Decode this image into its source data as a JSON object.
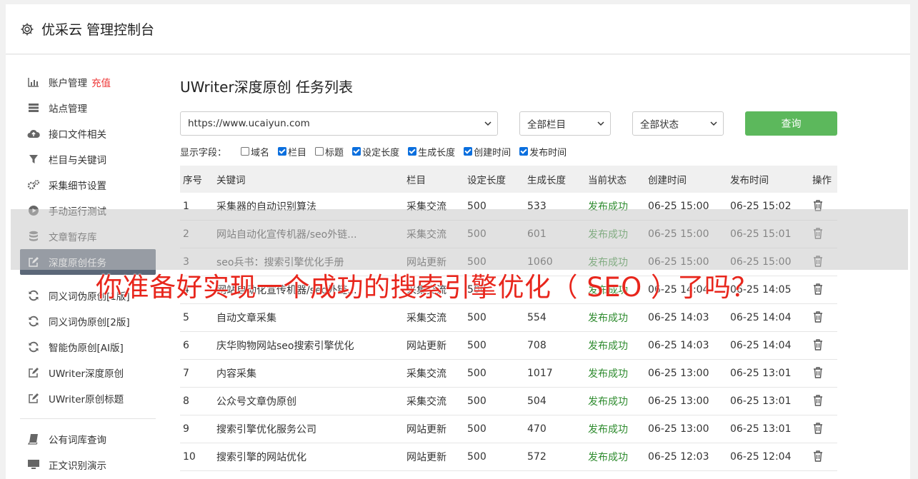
{
  "header": {
    "title": "优采云 管理控制台"
  },
  "sidebar": {
    "items": [
      {
        "label": "账户管理",
        "badge": "充值",
        "icon": "bar-chart-icon"
      },
      {
        "label": "站点管理",
        "icon": "server-icon"
      },
      {
        "label": "接口文件相关",
        "icon": "cloud-upload-icon"
      },
      {
        "label": "栏目与关键词",
        "icon": "filter-icon"
      },
      {
        "label": "采集细节设置",
        "icon": "gears-icon"
      },
      {
        "label": "手动运行测试",
        "icon": "play-icon"
      },
      {
        "label": "文章暂存库",
        "icon": "database-icon"
      },
      {
        "label": "深度原创任务",
        "icon": "edit-icon",
        "active": true
      },
      {
        "label": "同义词伪原创[1版]",
        "icon": "refresh-icon"
      },
      {
        "label": "同义词伪原创[2版]",
        "icon": "refresh-icon"
      },
      {
        "label": "智能伪原创[AI版]",
        "icon": "refresh-icon"
      },
      {
        "label": "UWriter深度原创",
        "icon": "edit-icon"
      },
      {
        "label": "UWriter原创标题",
        "icon": "edit-icon"
      },
      {
        "label": "公有词库查询",
        "icon": "book-icon"
      },
      {
        "label": "正文识别演示",
        "icon": "monitor-icon"
      }
    ]
  },
  "main": {
    "title": "UWriter深度原创 任务列表",
    "site_select": "https://www.ucaiyun.com",
    "column_select": "全部栏目",
    "status_select": "全部状态",
    "query_button": "查询",
    "fields_label": "显示字段：",
    "fields": [
      {
        "label": "域名",
        "checked": false
      },
      {
        "label": "栏目",
        "checked": true
      },
      {
        "label": "标题",
        "checked": false
      },
      {
        "label": "设定长度",
        "checked": true
      },
      {
        "label": "生成长度",
        "checked": true
      },
      {
        "label": "创建时间",
        "checked": true
      },
      {
        "label": "发布时间",
        "checked": true
      }
    ],
    "columns": [
      "序号",
      "关键词",
      "栏目",
      "设定长度",
      "生成长度",
      "当前状态",
      "创建时间",
      "发布时间",
      "操作"
    ],
    "rows": [
      [
        "1",
        "采集器的自动识别算法",
        "采集交流",
        "500",
        "533",
        "发布成功",
        "06-25 15:00",
        "06-25 15:02"
      ],
      [
        "2",
        "网站自动化宣传机器/seo外链...",
        "采集交流",
        "500",
        "601",
        "发布成功",
        "06-25 15:00",
        "06-25 15:01"
      ],
      [
        "3",
        "seo兵书：搜索引擎优化手册",
        "网站更新",
        "500",
        "1060",
        "发布成功",
        "06-25 15:00",
        "06-25 15:00"
      ],
      [
        "4",
        "网站自动化宣传机器/seo外链...",
        "采集交流",
        "500",
        "",
        "发布成功",
        "06-25 14:04",
        "06-25 14:05"
      ],
      [
        "5",
        "自动文章采集",
        "采集交流",
        "500",
        "554",
        "发布成功",
        "06-25 14:03",
        "06-25 14:04"
      ],
      [
        "6",
        "庆华购物网站seo搜索引擎优化",
        "网站更新",
        "500",
        "708",
        "发布成功",
        "06-25 14:03",
        "06-25 14:04"
      ],
      [
        "7",
        "内容采集",
        "采集交流",
        "500",
        "1017",
        "发布成功",
        "06-25 13:00",
        "06-25 13:01"
      ],
      [
        "8",
        "公众号文章伪原创",
        "采集交流",
        "500",
        "504",
        "发布成功",
        "06-25 13:00",
        "06-25 13:01"
      ],
      [
        "9",
        "搜索引擎优化服务公司",
        "网站更新",
        "500",
        "470",
        "发布成功",
        "06-25 13:00",
        "06-25 13:01"
      ],
      [
        "10",
        "搜索引擎的网站优化",
        "网站更新",
        "500",
        "572",
        "发布成功",
        "06-25 12:03",
        "06-25 12:04"
      ]
    ],
    "status_color": "#2e8b2e",
    "action_icon": "trash-icon"
  },
  "banner": {
    "text": "你准备好实现一个成功的搜索引擎优化（ SEO ）了吗？",
    "color": "#e8261c"
  }
}
